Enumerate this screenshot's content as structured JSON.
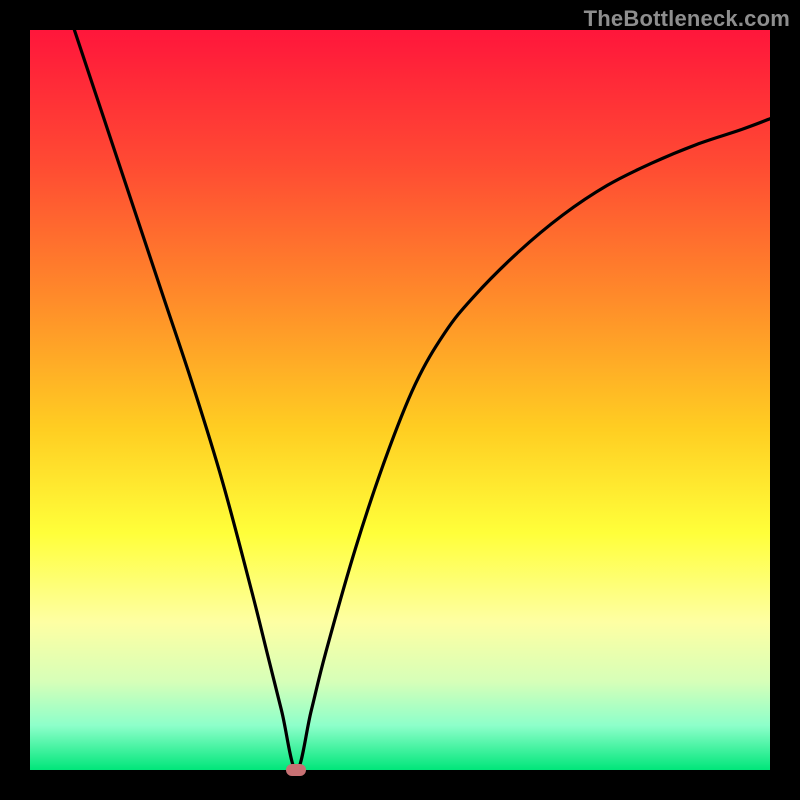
{
  "watermark": "TheBottleneck.com",
  "chart_data": {
    "type": "line",
    "title": "",
    "xlabel": "",
    "ylabel": "",
    "xlim": [
      0,
      100
    ],
    "ylim": [
      0,
      100
    ],
    "background": "gradient-heatmap",
    "minimum_point": {
      "x": 36,
      "y": 0
    },
    "series": [
      {
        "name": "bottleneck-curve",
        "x": [
          6,
          10,
          14,
          18,
          22,
          26,
          30,
          32,
          34,
          36,
          38,
          40,
          44,
          48,
          52,
          56,
          60,
          66,
          72,
          78,
          84,
          90,
          96,
          100
        ],
        "y": [
          100,
          88,
          76,
          64,
          52,
          39,
          24,
          16,
          8,
          0,
          8,
          16,
          30,
          42,
          52,
          59,
          64,
          70,
          75,
          79,
          82,
          84.5,
          86.5,
          88
        ]
      }
    ],
    "marker": {
      "x": 36,
      "y": 0,
      "color": "#c77073"
    },
    "gradient_stops": [
      {
        "pos": 0.0,
        "color": "#ff163b"
      },
      {
        "pos": 0.18,
        "color": "#ff4a33"
      },
      {
        "pos": 0.36,
        "color": "#ff8a2a"
      },
      {
        "pos": 0.54,
        "color": "#ffce22"
      },
      {
        "pos": 0.68,
        "color": "#ffff3a"
      },
      {
        "pos": 0.8,
        "color": "#feffa3"
      },
      {
        "pos": 0.88,
        "color": "#d7ffb8"
      },
      {
        "pos": 0.94,
        "color": "#8dffca"
      },
      {
        "pos": 1.0,
        "color": "#00e67a"
      }
    ]
  }
}
